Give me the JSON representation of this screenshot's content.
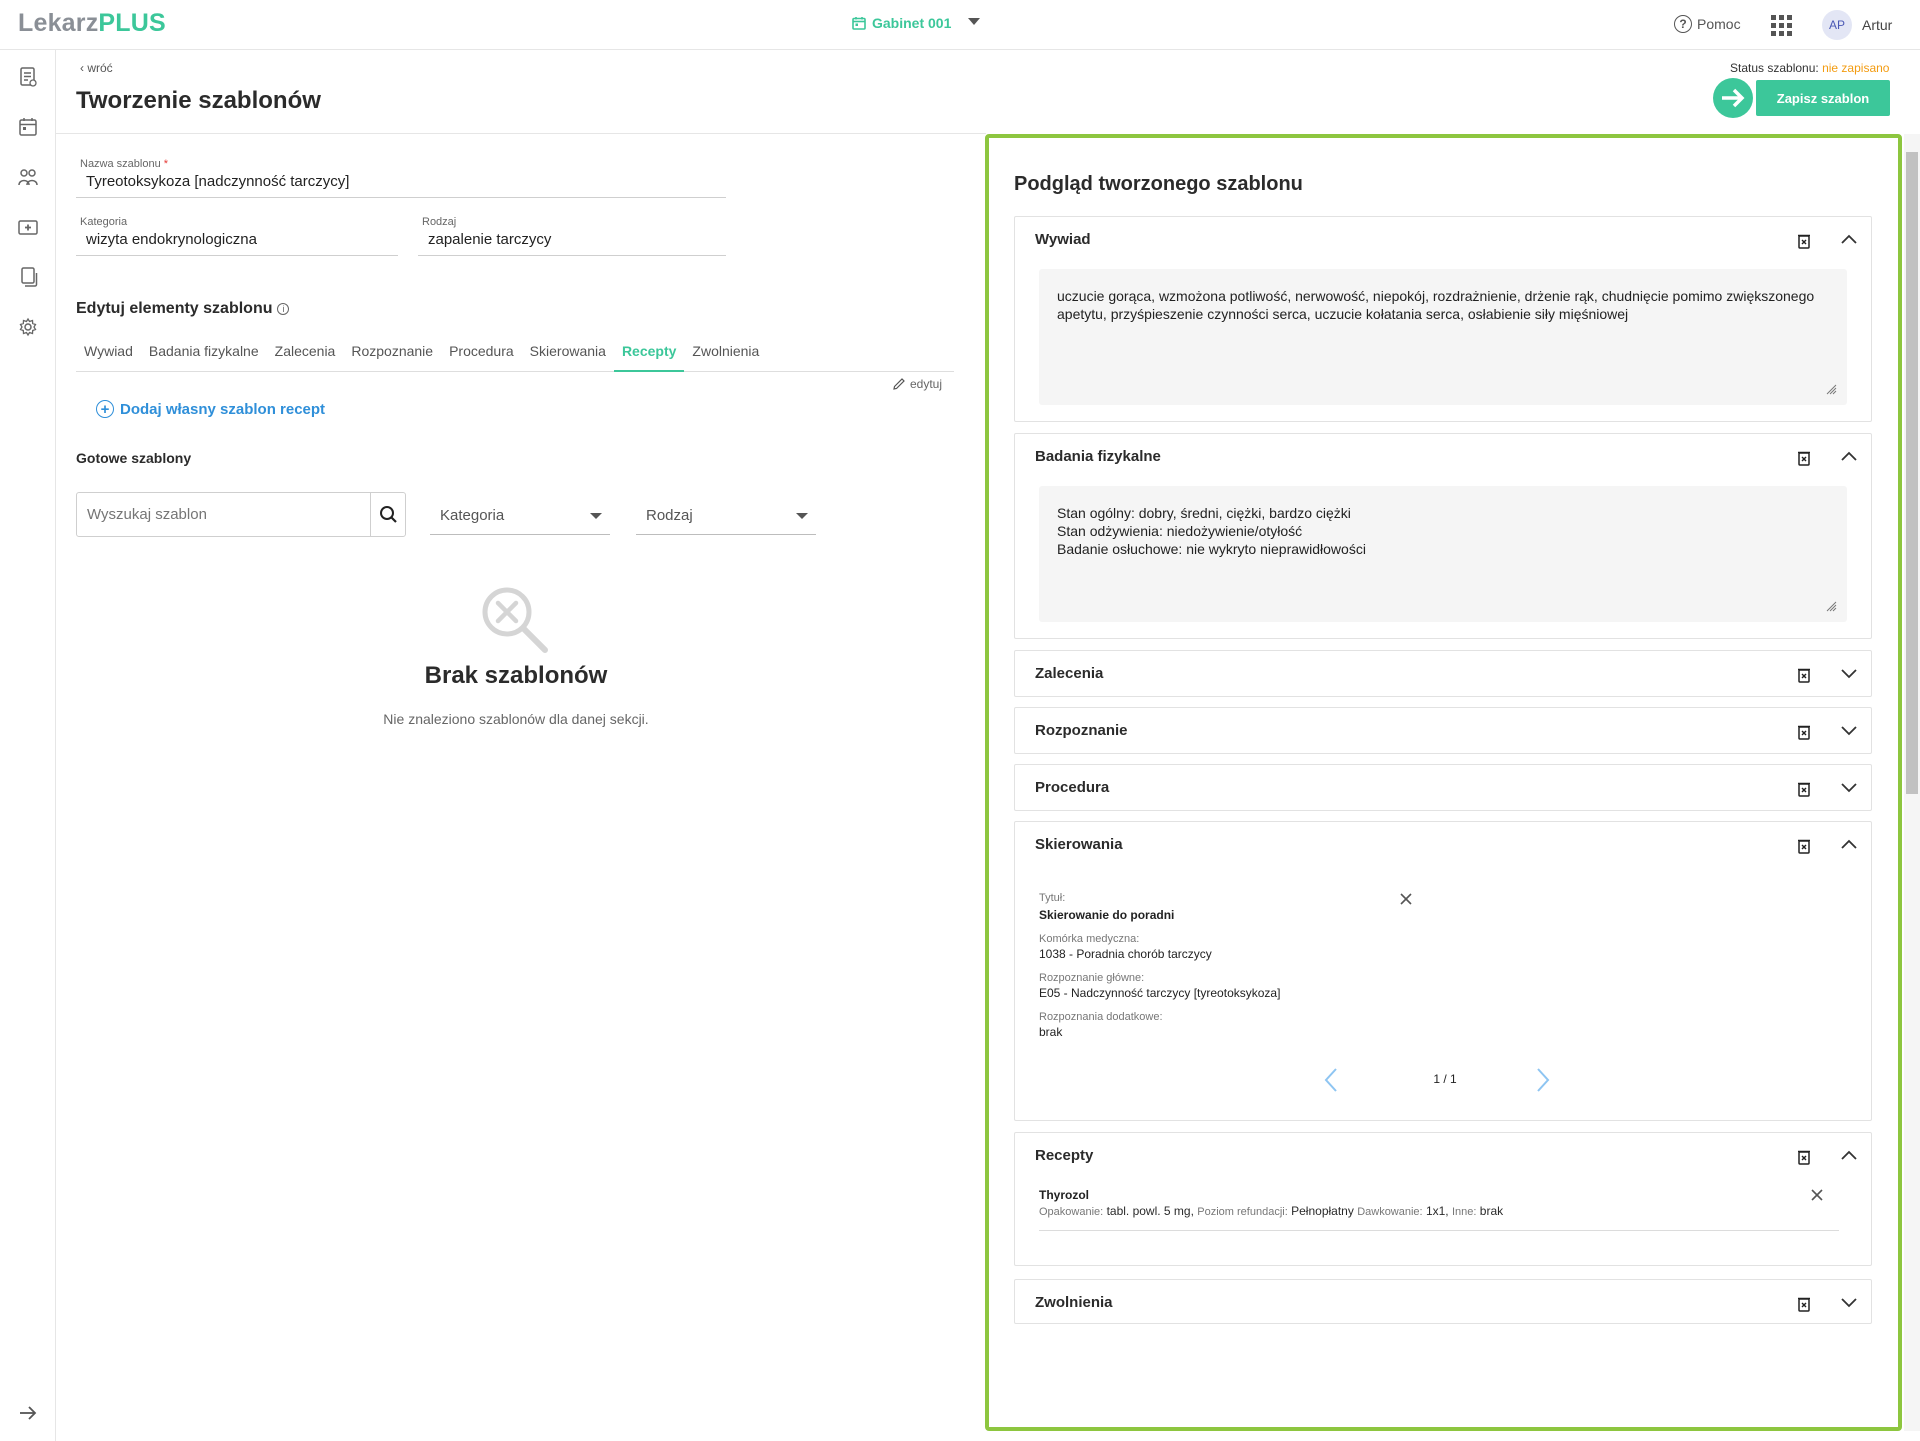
{
  "app": {
    "logo_left": "Lekarz",
    "logo_right": "PLUS",
    "office": "Gabinet 001",
    "help": "Pomoc",
    "avatar": "AP",
    "user": "Artur"
  },
  "sidebar": {
    "icons": [
      "document-icon",
      "calendar-icon",
      "patients-icon",
      "medical-case-icon",
      "copy-icon",
      "settings-icon"
    ],
    "bottom_icon": "arrow-right-icon"
  },
  "header": {
    "back": "wróć",
    "title": "Tworzenie szablonów",
    "status_label": "Status szablonu:",
    "status_value": "nie zapisano",
    "save": "Zapisz szablon"
  },
  "form": {
    "name_label": "Nazwa szablonu",
    "name_required": "*",
    "name_value": "Tyreotoksykoza [nadczynność tarczycy]",
    "category_label": "Kategoria",
    "category_value": "wizyta endokrynologiczna",
    "type_label": "Rodzaj",
    "type_value": "zapalenie tarczycy"
  },
  "editor": {
    "title": "Edytuj elementy szablonu",
    "tabs": [
      "Wywiad",
      "Badania fizykalne",
      "Zalecenia",
      "Rozpoznanie",
      "Procedura",
      "Skierowania",
      "Recepty",
      "Zwolnienia"
    ],
    "active_tab": "Recepty",
    "edit": "edytuj",
    "add_own": "Dodaj własny szablon recept",
    "ready_templates": "Gotowe szablony",
    "search_placeholder": "Wyszukaj szablon",
    "category_dd": "Kategoria",
    "type_dd": "Rodzaj",
    "empty_title": "Brak szablonów",
    "empty_desc": "Nie znaleziono szablonów dla danej sekcji."
  },
  "preview": {
    "title": "Podgląd tworzonego szablonu",
    "sections": {
      "wywiad": {
        "title": "Wywiad",
        "text": "uczucie gorąca, wzmożona potliwość, nerwowość, niepokój, rozdrażnienie, drżenie rąk, chudnięcie pomimo zwiększonego apetytu, przyśpieszenie czynności serca, uczucie kołatania serca, osłabienie siły mięśniowej"
      },
      "badania": {
        "title": "Badania fizykalne",
        "lines": [
          "Stan ogólny: dobry, średni, ciężki, bardzo ciężki",
          "Stan odżywienia: niedożywienie/otyłość",
          "Badanie osłuchowe: nie wykryto nieprawidłowości"
        ]
      },
      "zalecenia": {
        "title": "Zalecenia"
      },
      "rozpoznanie": {
        "title": "Rozpoznanie"
      },
      "procedura": {
        "title": "Procedura"
      },
      "skierowania": {
        "title": "Skierowania",
        "fields": [
          {
            "label": "Tytuł:",
            "value": "Skierowanie do poradni"
          },
          {
            "label": "Komórka medyczna:",
            "value": "1038 - Poradnia chorób tarczycy"
          },
          {
            "label": "Rozpoznanie główne:",
            "value": "E05 - Nadczynność tarczycy [tyreotoksykoza]"
          },
          {
            "label": "Rozpoznania dodatkowe:",
            "value": "brak"
          }
        ],
        "pager": "1 / 1"
      },
      "recepty": {
        "title": "Recepty",
        "drug": "Thyrozol",
        "details": [
          {
            "label": "Opakowanie:",
            "value": "tabl. powl. 5 mg,"
          },
          {
            "label": "Poziom refundacji:",
            "value": "Pełnopłatny"
          },
          {
            "label": "Dawkowanie:",
            "value": "1x1,"
          },
          {
            "label": "Inne:",
            "value": "brak"
          }
        ]
      },
      "zwolnienia": {
        "title": "Zwolnienia"
      }
    }
  },
  "colors": {
    "brand_green": "#3cc79a",
    "preview_border": "#8dc63f",
    "link_blue": "#2f8fd9",
    "status_orange": "#f39c12"
  }
}
